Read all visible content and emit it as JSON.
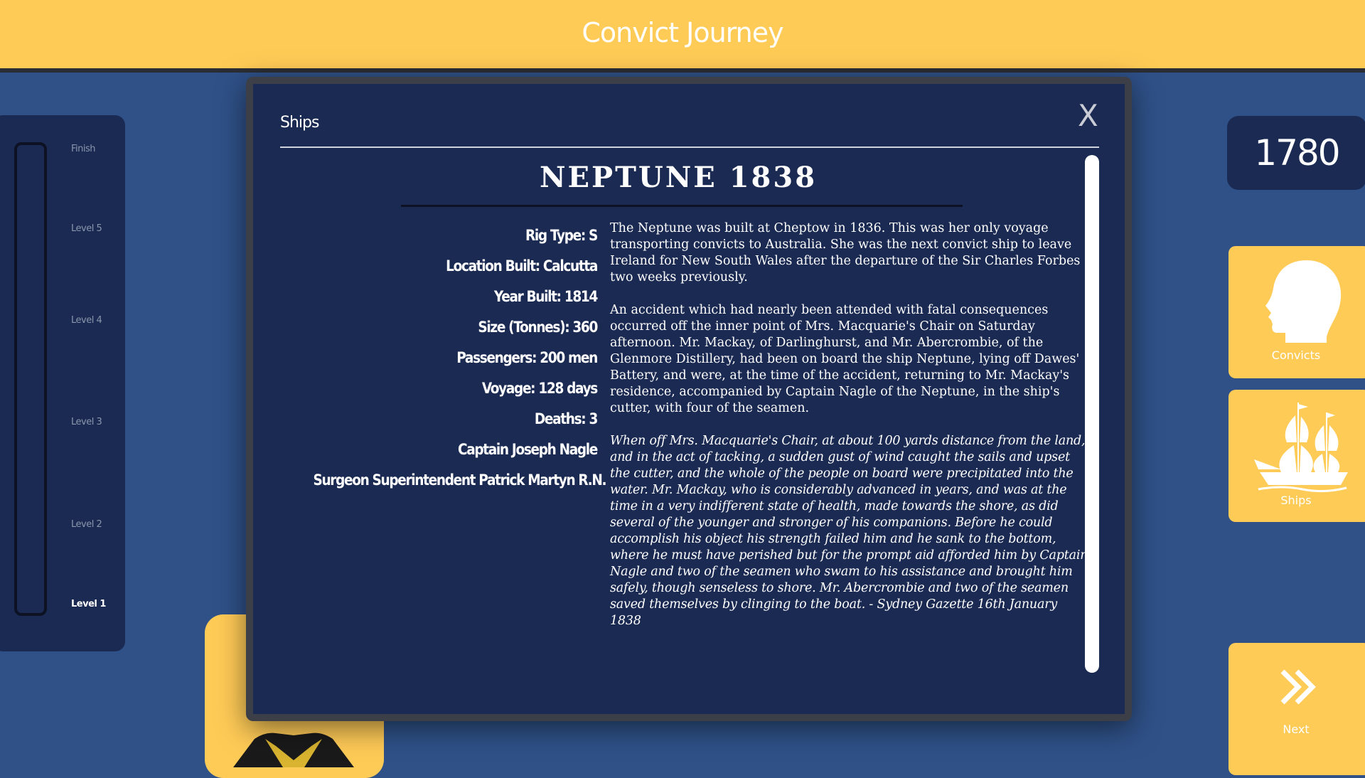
{
  "header": {
    "title": "Convict Journey"
  },
  "progress": {
    "levels": [
      "Finish",
      "Level 5",
      "Level 4",
      "Level 3",
      "Level 2",
      "Level 1"
    ],
    "active": "Level 1"
  },
  "year": "1780",
  "side_buttons": {
    "convicts": "Convicts",
    "ships": "Ships",
    "next": "Next"
  },
  "modal": {
    "header": "Ships",
    "close": "X",
    "ship_title": "NEPTUNE 1838",
    "facts": [
      "Rig Type: S",
      "Location Built: Calcutta",
      "Year Built: 1814",
      "Size (Tonnes): 360",
      "Passengers: 200 men",
      "Voyage: 128 days",
      "Deaths: 3",
      "Captain Joseph Nagle",
      "Surgeon Superintendent Patrick Martyn R.N."
    ],
    "paragraphs": [
      "The Neptune was built at Cheptow in 1836. This was her only voyage transporting convicts to Australia. She was the next convict ship to leave Ireland for New South Wales after the departure of the Sir Charles Forbes two weeks previously.",
      "An accident which had nearly been attended with fatal consequences occurred off the inner point of Mrs. Macquarie's Chair on Saturday afternoon. Mr. Mackay, of Darlinghurst, and Mr. Abercrombie, of the Glenmore Distillery, had been on board the ship Neptune, lying off Dawes' Battery, and were, at the time of the accident, returning to Mr. Mackay's residence, accompanied by Captain Nagle of the Neptune, in the ship's cutter, with four of the seamen."
    ],
    "quote": "When off Mrs. Macquarie's Chair, at about 100 yards distance from the land, and in the act of tacking, a sudden gust of wind caught the sails and upset the cutter, and the whole of the people on board were precipitated into the water. Mr. Mackay, who is considerably advanced in years, and was at the time in a very indifferent state of health, made towards the shore, as did several of the younger and stronger of his companions. Before he could accomplish his object his strength failed him and he sank to the bottom, where he must have perished but for the prompt aid afforded him by Captain Nagle and two of the seamen who swam to his assistance and brought him safely, though senseless to shore. Mr. Abercrombie and two of the seamen saved themselves by clinging to the boat. - Sydney Gazette 16th January 1838"
  }
}
